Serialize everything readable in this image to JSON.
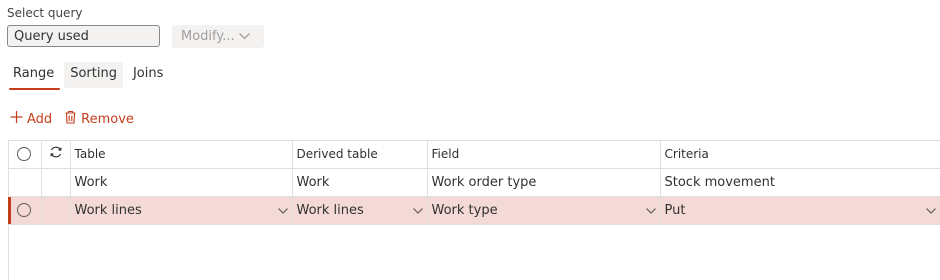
{
  "query": {
    "label": "Select query",
    "value": "Query used",
    "modify_label": "Modify..."
  },
  "tabs": [
    {
      "label": "Range",
      "active": true
    },
    {
      "label": "Sorting",
      "active": false
    },
    {
      "label": "Joins",
      "active": false
    }
  ],
  "toolbar": {
    "add_label": "Add",
    "remove_label": "Remove"
  },
  "grid": {
    "columns": [
      "Table",
      "Derived table",
      "Field",
      "Criteria"
    ],
    "rows": [
      {
        "table": "Work",
        "derived_table": "Work",
        "field": "Work order type",
        "criteria": "Stock movement",
        "selected": false
      },
      {
        "table": "Work lines",
        "derived_table": "Work lines",
        "field": "Work type",
        "criteria": "Put",
        "selected": true
      }
    ]
  },
  "colors": {
    "accent": "#c43e1c",
    "selected_row": "#f4dad6",
    "disabled_text": "#a19f9d"
  }
}
